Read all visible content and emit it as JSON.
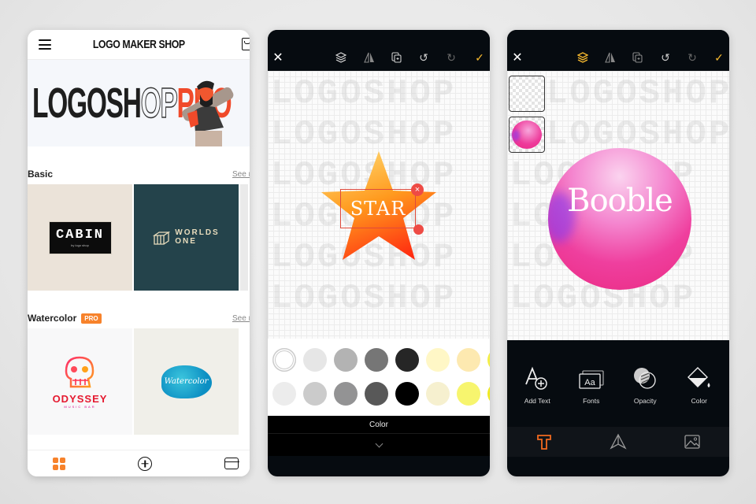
{
  "phone1": {
    "header_title": "LOGO MAKER SHOP",
    "hero": {
      "text_main": "LOGOSH",
      "text_outline": "OP",
      "text_accent": "PRO"
    },
    "sections": [
      {
        "title": "Basic",
        "see_more": "See more",
        "badge": null,
        "cards": [
          {
            "name": "CABIN",
            "sub": "by logo shop"
          },
          {
            "name": "WORLDS ONE",
            "line1": "WORLDS",
            "line2": "ONE"
          }
        ]
      },
      {
        "title": "Watercolor",
        "see_more": "See more",
        "badge": "PRO",
        "cards": [
          {
            "name": "ODYSSEY",
            "sub": "MUSIC BAR"
          },
          {
            "name": "Watercolor"
          }
        ]
      }
    ],
    "tabbar": [
      {
        "icon": "grid-icon",
        "active": true
      },
      {
        "icon": "plus-circle-icon"
      },
      {
        "icon": "tray-icon"
      }
    ]
  },
  "phone2": {
    "toolbar": [
      {
        "icon": "close-icon",
        "glyph": "✕"
      },
      {
        "icon": "layers-icon"
      },
      {
        "icon": "flip-icon"
      },
      {
        "icon": "duplicate-icon"
      },
      {
        "icon": "undo-icon",
        "glyph": "↺"
      },
      {
        "icon": "redo-icon",
        "glyph": "↻"
      },
      {
        "icon": "check-icon",
        "glyph": "✓"
      }
    ],
    "watermark": "LOGOSHOP",
    "canvas_text": "STAR",
    "close_glyph": "×",
    "palette": {
      "row1": [
        "#ffffff",
        "#e6e6e6",
        "#b3b3b3",
        "#767676",
        "#262626",
        "#fff7c6",
        "#fde9b0",
        "#f4ef45"
      ],
      "row2": [
        "#ececec",
        "#cbcbcb",
        "#939394",
        "#585858",
        "#000000",
        "#f6f0cf",
        "#f7f56e",
        "#f0ea20"
      ],
      "selected": "#ffffff"
    },
    "panel_label": "Color"
  },
  "phone3": {
    "watermark": "LOGOSHOP",
    "canvas_text": "Booble",
    "tools": [
      {
        "icon": "add-text-icon",
        "label": "Add Text"
      },
      {
        "icon": "fonts-icon",
        "label": "Fonts",
        "glyph": "Aa"
      },
      {
        "icon": "opacity-icon",
        "label": "Opacity"
      },
      {
        "icon": "color-fill-icon",
        "label": "Color"
      }
    ],
    "bottom_tabs": [
      {
        "icon": "text-tool-icon",
        "active": true
      },
      {
        "icon": "shape-tool-icon"
      },
      {
        "icon": "image-tool-icon"
      }
    ]
  },
  "colors": {
    "accent": "#f7822b",
    "check": "#f5b82e",
    "selection": "#ee4b45",
    "editor_bg": "#060b10"
  }
}
